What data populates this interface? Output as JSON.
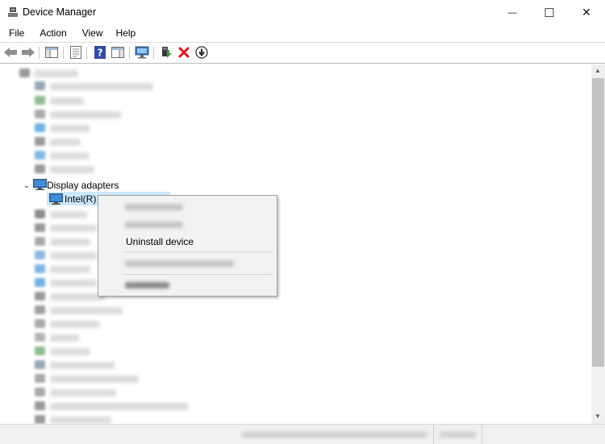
{
  "window": {
    "title": "Device Manager",
    "controls": {
      "minimize": "—",
      "maximize": "☐",
      "close": "✕"
    }
  },
  "menu": {
    "items": [
      {
        "label": "File"
      },
      {
        "label": "Action"
      },
      {
        "label": "View"
      },
      {
        "label": "Help"
      }
    ]
  },
  "toolbar": {
    "icons": [
      "back-icon",
      "forward-icon",
      "show-hide-console-tree-icon",
      "properties-icon",
      "help-icon",
      "action-pane-icon",
      "scan-hardware-icon",
      "update-driver-icon",
      "uninstall-icon",
      "disable-device-icon"
    ]
  },
  "tree": {
    "category": {
      "label": "Display adapters",
      "expanded": true
    },
    "device": {
      "label": "Intel(R) U"
    }
  },
  "context_menu": {
    "uninstall_label": "Uninstall device"
  },
  "colors": {
    "selection": "#cce8ff",
    "uninstall_red": "#e81123",
    "menu_bg": "#f2f2f2"
  }
}
